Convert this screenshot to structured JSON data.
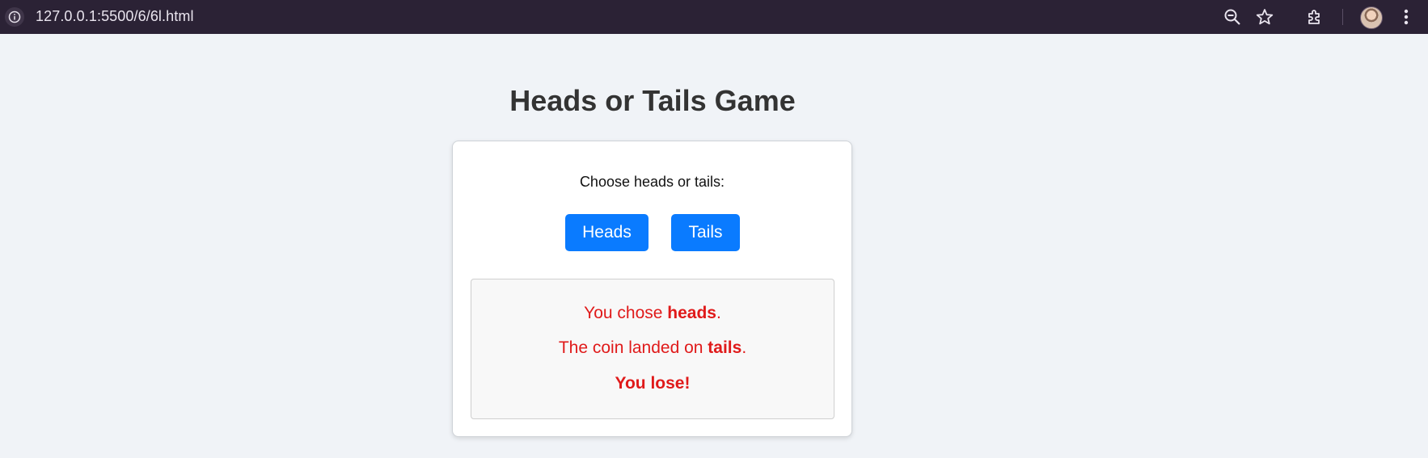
{
  "browser": {
    "url": "127.0.0.1:5500/6/6l.html",
    "icons": [
      "info-icon",
      "zoom-out-icon",
      "star-icon",
      "extensions-icon",
      "profile-avatar",
      "more-menu-icon"
    ]
  },
  "page": {
    "title": "Heads or Tails Game",
    "prompt": "Choose heads or tails:",
    "buttons": {
      "heads_label": "Heads",
      "tails_label": "Tails"
    },
    "result": {
      "line1_prefix": "You chose ",
      "line1_choice": "heads",
      "line1_suffix": ".",
      "line2_prefix": "The coin landed on ",
      "line2_outcome": "tails",
      "line2_suffix": ".",
      "verdict": "You lose!"
    }
  },
  "colors": {
    "background": "#f0f3f7",
    "button": "#0a7bff",
    "result_text": "#e01a1a",
    "browser_bar": "#2b2235"
  }
}
